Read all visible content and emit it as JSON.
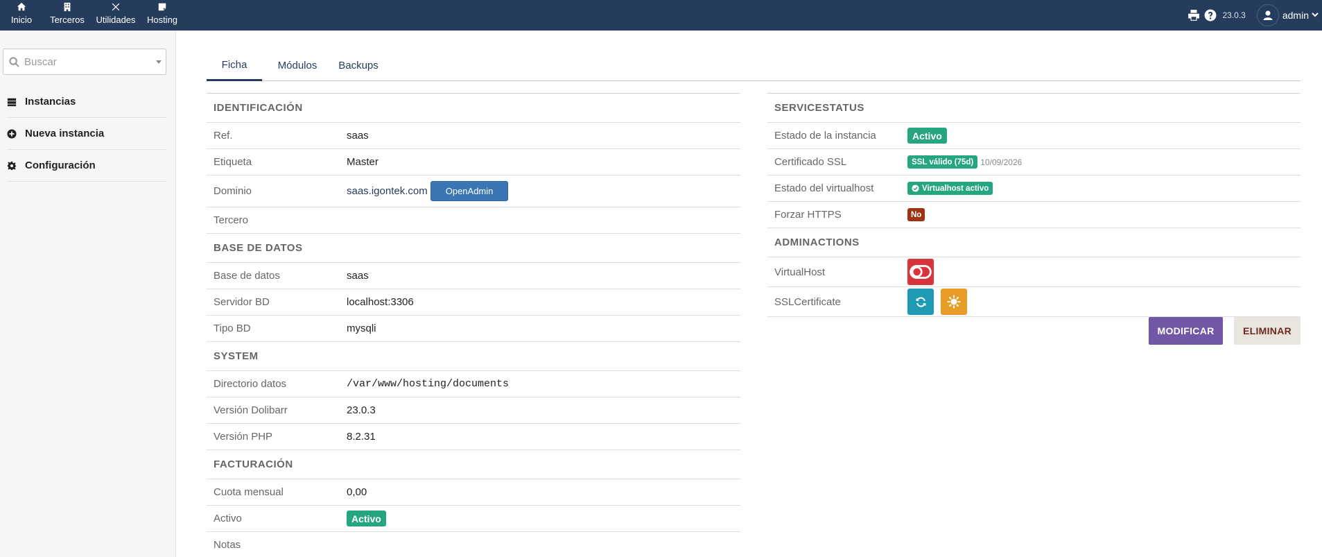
{
  "topnav": {
    "items": [
      {
        "label": "Inicio",
        "icon": "home-icon"
      },
      {
        "label": "Terceros",
        "icon": "building-icon"
      },
      {
        "label": "Utilidades",
        "icon": "tools-icon"
      },
      {
        "label": "Hosting",
        "icon": "note-icon"
      }
    ],
    "active": "Hosting"
  },
  "topright": {
    "version": "23.0.3",
    "username": "admin"
  },
  "sidebar": {
    "search_placeholder": "Buscar",
    "items": [
      {
        "label": "Instancias",
        "icon": "server-icon"
      },
      {
        "label": "Nueva instancia",
        "icon": "plus-circle-icon"
      },
      {
        "label": "Configuración",
        "icon": "gear-icon"
      }
    ]
  },
  "tabs": [
    {
      "label": "Ficha",
      "active": true
    },
    {
      "label": "Módulos",
      "active": false
    },
    {
      "label": "Backups",
      "active": false
    }
  ],
  "left": {
    "identificacion": {
      "title": "IDENTIFICACIÓN",
      "ref_label": "Ref.",
      "ref_value": "saas",
      "etiqueta_label": "Etiqueta",
      "etiqueta_value": "Master",
      "dominio_label": "Dominio",
      "dominio_value": "saas.igontek.com",
      "openadmin_label": "OpenAdmin",
      "tercero_label": "Tercero"
    },
    "basedatos": {
      "title": "BASE DE DATOS",
      "bd_label": "Base de datos",
      "bd_value": "saas",
      "servidor_label": "Servidor BD",
      "servidor_value": "localhost:3306",
      "tipo_label": "Tipo BD",
      "tipo_value": "mysqli"
    },
    "system": {
      "title": "SYSTEM",
      "dir_label": "Directorio datos",
      "dir_value": "/var/www/hosting/documents",
      "dolibarr_label": "Versión Dolibarr",
      "dolibarr_value": "23.0.3",
      "php_label": "Versión PHP",
      "php_value": "8.2.31"
    },
    "facturacion": {
      "title": "FACTURACIÓN",
      "cuota_label": "Cuota mensual",
      "cuota_value": "0,00",
      "activo_label": "Activo",
      "activo_value": "Activo",
      "notas_label": "Notas"
    }
  },
  "right": {
    "servicestatus": {
      "title": "SERVICESTATUS",
      "estado_label": "Estado de la instancia",
      "estado_value": "Activo",
      "ssl_label": "Certificado SSL",
      "ssl_value": "SSL válido (75d)",
      "ssl_date": "10/09/2026",
      "vhost_label": "Estado del virtualhost",
      "vhost_value": "Virtualhost activo",
      "https_label": "Forzar HTTPS",
      "https_value": "No"
    },
    "adminactions": {
      "title": "ADMINACTIONS",
      "vhost_label": "VirtualHost",
      "ssl_label": "SSLCertificate"
    }
  },
  "buttons": {
    "modify": "MODIFICAR",
    "delete": "ELIMINAR"
  },
  "colors": {
    "topbar": "#263c5c",
    "green": "#25a580",
    "red_badge": "#9e3214",
    "modify": "#7257a6",
    "openadmin": "#3a76b4",
    "toggle": "#d9343b",
    "renew": "#1f9ab3",
    "sun": "#e89b25"
  }
}
